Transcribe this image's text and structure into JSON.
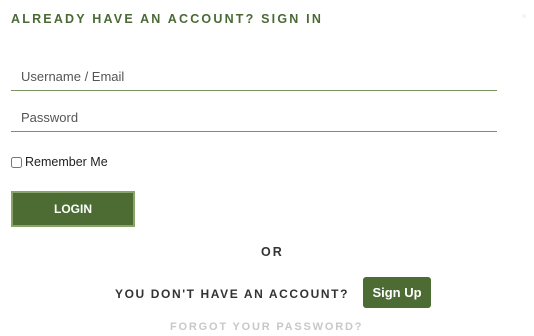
{
  "signin": {
    "heading": "ALREADY HAVE AN ACCOUNT? SIGN IN",
    "username_placeholder": "Username / Email",
    "password_placeholder": "Password",
    "remember_label": "Remember Me",
    "login_label": "LOGIN"
  },
  "separator": {
    "or_label": "OR"
  },
  "signup": {
    "prompt": "YOU DON'T HAVE AN ACCOUNT?",
    "button_label": "Sign Up"
  },
  "forgot": {
    "link_label": "FORGOT YOUR PASSWORD?"
  },
  "colors": {
    "accent": "#4c6c33",
    "heading": "#4a6a35",
    "muted": "#c8c8c8"
  }
}
